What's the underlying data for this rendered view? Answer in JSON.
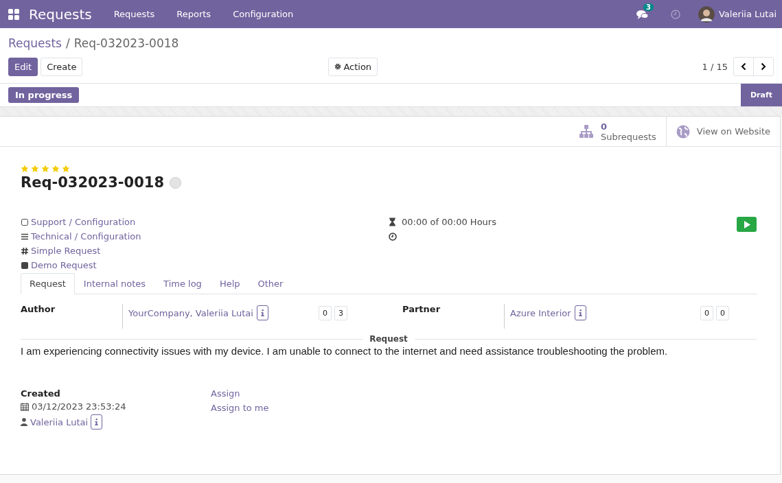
{
  "navbar": {
    "app_name": "Requests",
    "menu": [
      "Requests",
      "Reports",
      "Configuration"
    ],
    "messages_badge": "3",
    "user_name": "Valeriia Lutai"
  },
  "breadcrumb": {
    "parent": "Requests",
    "separator": "/",
    "current": "Req-032023-0018"
  },
  "buttons": {
    "edit": "Edit",
    "create": "Create",
    "action": "Action"
  },
  "pager": {
    "text": "1 / 15"
  },
  "status_bar": {
    "action_button": "In progress",
    "stages": [
      {
        "label": "Draft",
        "selected": true
      }
    ]
  },
  "button_box": {
    "subrequests_count": "0",
    "subrequests_label": "Subrequests",
    "website": "View on Website"
  },
  "record": {
    "stars": 5,
    "name": "Req-032023-0018",
    "tags": [
      {
        "kind": "square",
        "text": "Support / Configuration"
      },
      {
        "kind": "bars",
        "text": "Technical / Configuration"
      },
      {
        "kind": "hash",
        "text": "Simple Request"
      },
      {
        "kind": "filled",
        "text": "Demo Request"
      }
    ],
    "time": "00:00 of 00:00 Hours"
  },
  "tabs": [
    {
      "label": "Request",
      "selected": true
    },
    {
      "label": "Internal notes",
      "selected": false
    },
    {
      "label": "Time log",
      "selected": false
    },
    {
      "label": "Help",
      "selected": false
    },
    {
      "label": "Other",
      "selected": false
    }
  ],
  "contacts": [
    {
      "label": "Author",
      "value": "YourCompany, Valeriia Lutai",
      "counts": [
        "0",
        "3"
      ]
    },
    {
      "label": "Partner",
      "value": "Azure Interior",
      "counts": [
        "0",
        "0"
      ]
    }
  ],
  "request": {
    "separator": "Request",
    "text": "I am experiencing connectivity issues with my device. I am unable to connect to the internet and need assistance troubleshooting the problem."
  },
  "created": {
    "label": "Created",
    "date": "03/12/2023 23:53:24",
    "user": "Valeriia Lutai"
  },
  "assign": [
    "Assign",
    "Assign to me"
  ]
}
